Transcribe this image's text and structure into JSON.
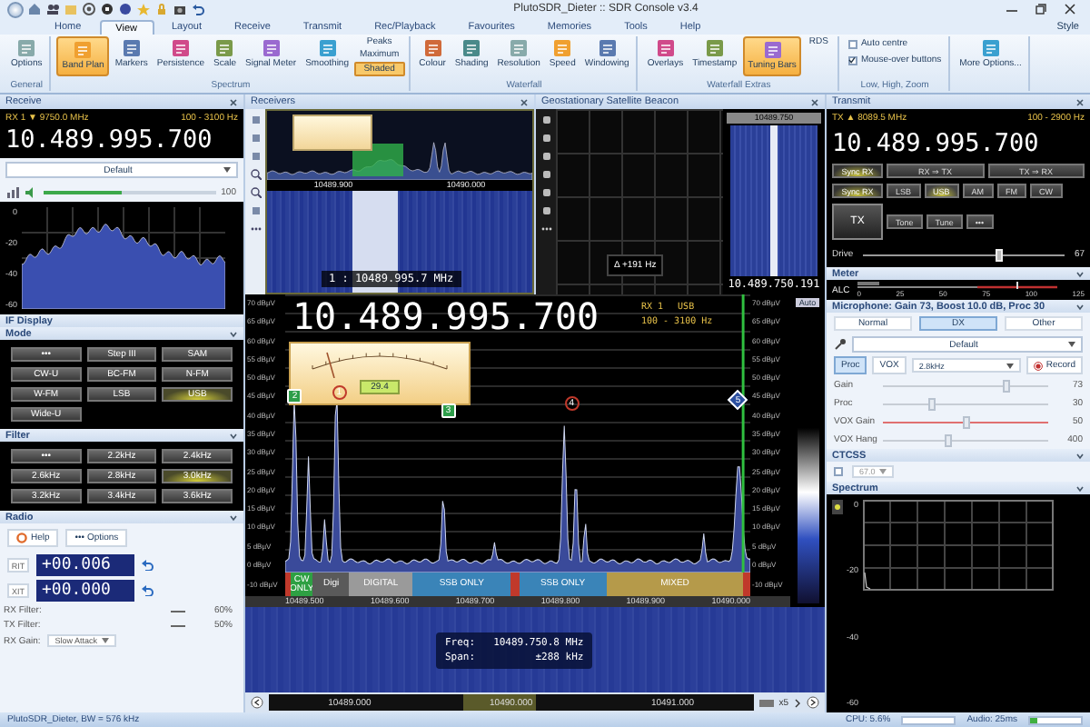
{
  "window": {
    "title": "PlutoSDR_Dieter :: SDR Console v3.4"
  },
  "tabs": [
    {
      "label": "Home",
      "selected": false
    },
    {
      "label": "View",
      "selected": true
    },
    {
      "label": "Layout",
      "selected": false
    },
    {
      "label": "Receive",
      "selected": false
    },
    {
      "label": "Transmit",
      "selected": false
    },
    {
      "label": "Rec/Playback",
      "selected": false
    },
    {
      "label": "Favourites",
      "selected": false
    },
    {
      "label": "Memories",
      "selected": false
    },
    {
      "label": "Tools",
      "selected": false
    },
    {
      "label": "Help",
      "selected": false
    }
  ],
  "style_menu": "Style",
  "ribbon_groups": [
    {
      "title": "General",
      "items": [
        {
          "kind": "large",
          "label": "Options",
          "selected": false
        }
      ]
    },
    {
      "title": "Spectrum",
      "items": [
        {
          "kind": "large",
          "label": "Band Plan",
          "selected": true
        },
        {
          "kind": "large",
          "label": "Markers",
          "selected": false
        },
        {
          "kind": "large",
          "label": "Persistence",
          "selected": false
        },
        {
          "kind": "large",
          "label": "Scale",
          "selected": false
        },
        {
          "kind": "large",
          "label": "Signal Meter",
          "selected": false
        },
        {
          "kind": "large",
          "label": "Smoothing",
          "selected": false
        },
        {
          "kind": "small",
          "label": "Peaks",
          "selected": false
        },
        {
          "kind": "small",
          "label": "Maximum",
          "selected": false
        },
        {
          "kind": "small",
          "label": "Shaded",
          "selected": true
        }
      ]
    },
    {
      "title": "Waterfall",
      "items": [
        {
          "kind": "large",
          "label": "Colour",
          "selected": false
        },
        {
          "kind": "large",
          "label": "Shading",
          "selected": false
        },
        {
          "kind": "large",
          "label": "Resolution",
          "selected": false
        },
        {
          "kind": "large",
          "label": "Speed",
          "selected": false
        },
        {
          "kind": "large",
          "label": "Windowing",
          "selected": false
        }
      ]
    },
    {
      "title": "Waterfall Extras",
      "items": [
        {
          "kind": "large",
          "label": "Overlays",
          "selected": false
        },
        {
          "kind": "large",
          "label": "Timestamp",
          "selected": false
        },
        {
          "kind": "large",
          "label": "Tuning Bars",
          "selected": true
        },
        {
          "kind": "small",
          "label": "RDS",
          "selected": false
        }
      ]
    },
    {
      "title": "Low, High, Zoom",
      "items": [
        {
          "kind": "check",
          "label": "Auto centre",
          "checked": false
        },
        {
          "kind": "check",
          "label": "Mouse-over buttons",
          "checked": true
        }
      ]
    },
    {
      "items": [
        {
          "kind": "large",
          "label": "More Options...",
          "selected": false
        }
      ]
    }
  ],
  "receive": {
    "title": "Receive",
    "rx_label": "RX 1 ▼ 9750.0 MHz",
    "bandwidth": "100 - 3100 Hz",
    "frequency": "10.489.995.700",
    "preset": "Default",
    "volume": {
      "level": 0.45,
      "reading": "100"
    },
    "spectrum": {
      "y_labels": [
        "0",
        "-20",
        "-40",
        "-60"
      ]
    },
    "if_display": "IF Display",
    "mode": {
      "title": "Mode",
      "buttons": [
        {
          "label": "•••",
          "selected": false
        },
        {
          "label": "Step III",
          "selected": false
        },
        {
          "label": "SAM",
          "selected": false
        },
        {
          "label": "CW-U",
          "selected": false
        },
        {
          "label": "BC-FM",
          "selected": false
        },
        {
          "label": "N-FM",
          "selected": false
        },
        {
          "label": "W-FM",
          "selected": false
        },
        {
          "label": "LSB",
          "selected": false
        },
        {
          "label": "USB",
          "selected": true
        },
        {
          "label": "Wide-U",
          "selected": false
        }
      ]
    },
    "filter": {
      "title": "Filter",
      "buttons": [
        {
          "label": "•••",
          "selected": false
        },
        {
          "label": "2.2kHz",
          "selected": false
        },
        {
          "label": "2.4kHz",
          "selected": false
        },
        {
          "label": "2.6kHz",
          "selected": false
        },
        {
          "label": "2.8kHz",
          "selected": false
        },
        {
          "label": "3.0kHz",
          "selected": true
        },
        {
          "label": "3.2kHz",
          "selected": false
        },
        {
          "label": "3.4kHz",
          "selected": false
        },
        {
          "label": "3.6kHz",
          "selected": false
        }
      ]
    },
    "radio": {
      "title": "Radio",
      "help": "Help",
      "options": "••• Options",
      "offsets": [
        {
          "label": "RIT",
          "value": "+00.006"
        },
        {
          "label": "XIT",
          "value": "+00.000"
        }
      ],
      "filters": [
        {
          "label": "RX Filter:",
          "reading": "60%"
        },
        {
          "label": "TX Filter:",
          "reading": "50%"
        }
      ],
      "gain_label": "RX Gain:",
      "gain_value": "Slow Attack"
    }
  },
  "receivers": {
    "title": "Receivers",
    "freq_labels": [
      "10489.900",
      "10490.000"
    ],
    "vfo_label": "1 : 10489.995.7 MHz"
  },
  "beacon": {
    "title": "Geostationary Satellite Beacon",
    "offset": "Δ +191 Hz",
    "marker_freq": "10489.750",
    "frequency": "10.489.750.191"
  },
  "spectrum": {
    "frequency": "10.489.995.700",
    "rx": "RX 1",
    "mode": "USB",
    "bandwidth": "100 - 3100 Hz",
    "meter_reading": "29.4",
    "y_labels": [
      "70 dBµV",
      "65 dBµV",
      "60 dBµV",
      "55 dBµV",
      "50 dBµV",
      "45 dBµV",
      "40 dBµV",
      "35 dBµV",
      "30 dBµV",
      "25 dBµV",
      "20 dBµV",
      "15 dBµV",
      "10 dBµV",
      "5 dBµV",
      "0 dBµV"
    ],
    "floor_label": "-10 dBµV",
    "right_y_labels": [
      "70 dBµV",
      "65 dBµV",
      "60 dBµV",
      "55 dBµV",
      "50 dBµV",
      "45 dBµV",
      "40 dBµV",
      "35 dBµV",
      "30 dBµV",
      "25 dBµV",
      "20 dBµV",
      "15 dBµV",
      "10 dBµV",
      "5 dBµV",
      "0 dBµV"
    ],
    "right_floor_label": "-10 dBµV",
    "markers": [
      {
        "label": "2",
        "kind": "square",
        "color": "#2e9e4a"
      },
      {
        "label": "1",
        "kind": "circle",
        "color": "#c0392b"
      },
      {
        "label": "3",
        "kind": "square",
        "color": "#2e9e4a"
      },
      {
        "label": "4",
        "kind": "circle",
        "color": "#c0392b"
      },
      {
        "label": "5",
        "kind": "diamond",
        "color": "#2b4fa0"
      }
    ],
    "band_segments": [
      {
        "color": "#c0392b"
      },
      {
        "label": "CW ONLY",
        "color": "#2ea043"
      },
      {
        "label": "Digi",
        "color": "#5a5a5a"
      },
      {
        "label": "DIGITAL",
        "color": "#9a9a9a"
      },
      {
        "label": "SSB ONLY",
        "color": "#3a84b8"
      },
      {
        "color": "#c0392b"
      },
      {
        "label": "SSB ONLY",
        "color": "#3a84b8"
      },
      {
        "label": "MIXED",
        "color": "#b59a4a"
      },
      {
        "color": "#c0392b"
      }
    ],
    "x_labels": [
      "10489.500",
      "10489.600",
      "10489.700",
      "10489.800",
      "10489.900",
      "10490.000"
    ],
    "scale_label": "Auto"
  },
  "waterfall": {
    "freq_label": "Freq:",
    "freq": "10489.750.8 MHz",
    "span_label": "Span:",
    "span": "±288 kHz",
    "nav_labels": [
      "10489.000",
      "10490.000",
      "10491.000"
    ],
    "zoom": "x5"
  },
  "transmit": {
    "title": "Transmit",
    "tx_label": "TX ▲ 8089.5 MHz",
    "bandwidth": "100 - 2900 Hz",
    "frequency": "10.489.995.700",
    "sync_buttons": [
      {
        "label": "Sync RX",
        "kind": "sync"
      },
      {
        "label": "RX ⇒ TX",
        "kind": "plain"
      },
      {
        "label": "TX ⇒ RX",
        "kind": "plain"
      }
    ],
    "sync_mode": "Sync RX",
    "modes": [
      {
        "label": "LSB",
        "selected": false
      },
      {
        "label": "USB",
        "selected": true
      },
      {
        "label": "AM",
        "selected": false
      },
      {
        "label": "FM",
        "selected": false
      },
      {
        "label": "CW",
        "selected": false
      }
    ],
    "tx_button": "TX",
    "tone": "Tone",
    "tune": "Tune",
    "more": "•••",
    "drive": {
      "label": "Drive",
      "level": 0.67,
      "reading": "67"
    }
  },
  "meter": {
    "title": "Meter",
    "label": "ALC",
    "scale": [
      "0",
      "25",
      "50",
      "75",
      "100",
      "125"
    ]
  },
  "microphone": {
    "title": "Microphone: Gain 73, Boost 10.0 dB, Proc 30",
    "profiles": [
      {
        "label": "Normal",
        "selected": false
      },
      {
        "label": "DX",
        "selected": true
      },
      {
        "label": "Other",
        "selected": false
      }
    ],
    "preset": "Default",
    "toggles": [
      {
        "label": "Proc",
        "on": true
      },
      {
        "label": "VOX",
        "on": false
      }
    ],
    "bandwidth": "2.8kHz",
    "record": "Record",
    "sliders": [
      {
        "label": "Gain",
        "level": 0.75,
        "reading": "73",
        "kind": "plain"
      },
      {
        "label": "Proc",
        "level": 0.3,
        "reading": "30",
        "kind": "plain"
      },
      {
        "label": "VOX Gain",
        "level": 0.5,
        "reading": "50",
        "kind": "red"
      },
      {
        "label": "VOX Hang",
        "level": 0.4,
        "reading": "400",
        "kind": "plain"
      }
    ]
  },
  "ctcss": {
    "title": "CTCSS",
    "checked": false,
    "tone": "67.0"
  },
  "tx_spectrum": {
    "title": "Spectrum",
    "y_labels": [
      "0",
      "-20",
      "-40",
      "-60"
    ]
  },
  "status_bar": {
    "text": "PlutoSDR_Dieter, BW = 576 kHz",
    "cpu": "CPU: 5.6%",
    "audio": "Audio: 25ms",
    "audio_meter": {
      "level": 0.15
    }
  }
}
